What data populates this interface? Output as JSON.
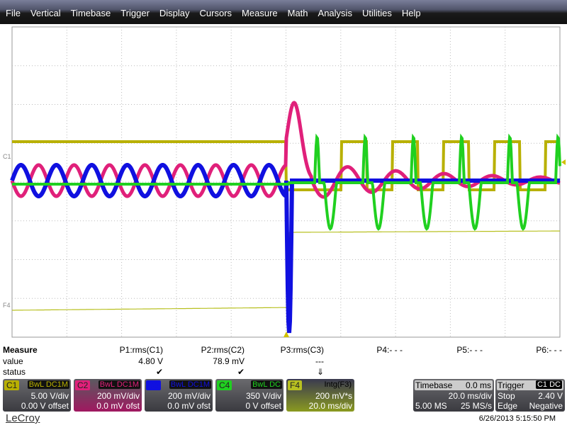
{
  "menu": [
    "File",
    "Vertical",
    "Timebase",
    "Trigger",
    "Display",
    "Cursors",
    "Measure",
    "Math",
    "Analysis",
    "Utilities",
    "Help"
  ],
  "colors": {
    "C1": "#b8b000",
    "C2": "#e0207a",
    "C3": "#1010e0",
    "C4": "#20d020",
    "F4": "#b8c020"
  },
  "markers": {
    "c1": "C1",
    "f4": "F4"
  },
  "measure": {
    "title": "Measure",
    "row_value": "value",
    "row_status": "status",
    "params": [
      {
        "name": "P1:rms(C1)",
        "value": "4.80 V",
        "status": "✔"
      },
      {
        "name": "P2:rms(C2)",
        "value": "78.9 mV",
        "status": "✔"
      },
      {
        "name": "P3:rms(C3)",
        "value": "---",
        "status": "⇓"
      },
      {
        "name": "P4:- - -",
        "value": "",
        "status": ""
      },
      {
        "name": "P5:- - -",
        "value": "",
        "status": ""
      },
      {
        "name": "P6:- - -",
        "value": "",
        "status": ""
      }
    ]
  },
  "channels": [
    {
      "tag": "C1",
      "coupling": "BwL DC1M",
      "scale": "5.00 V/div",
      "offset": "0.00 V offset"
    },
    {
      "tag": "C2",
      "coupling": "BwL DC1M",
      "scale": "200 mV/div",
      "offset": "0.0 mV ofst"
    },
    {
      "tag": "C3",
      "coupling": "BwL DC1M",
      "scale": "200 mV/div",
      "offset": "0.0 mV ofst"
    },
    {
      "tag": "C4",
      "coupling": "BwL DC",
      "scale": "350 V/div",
      "offset": "0 V offset"
    },
    {
      "tag": "F4",
      "func": "Intg(F3)",
      "scale": "200 mV*s",
      "offset": "20.0 ms/div"
    }
  ],
  "timebase": {
    "label": "Timebase",
    "delay": "0.0 ms",
    "div": "20.0 ms/div",
    "samples": "5.00 MS",
    "rate": "25 MS/s"
  },
  "trigger": {
    "label": "Trigger",
    "source": "C1",
    "coupling": "DC",
    "mode": "Stop",
    "level": "2.40 V",
    "type": "Edge",
    "slope": "Negative"
  },
  "brand": "LeCroy",
  "datetime": "6/26/2013 5:15:50 PM"
}
